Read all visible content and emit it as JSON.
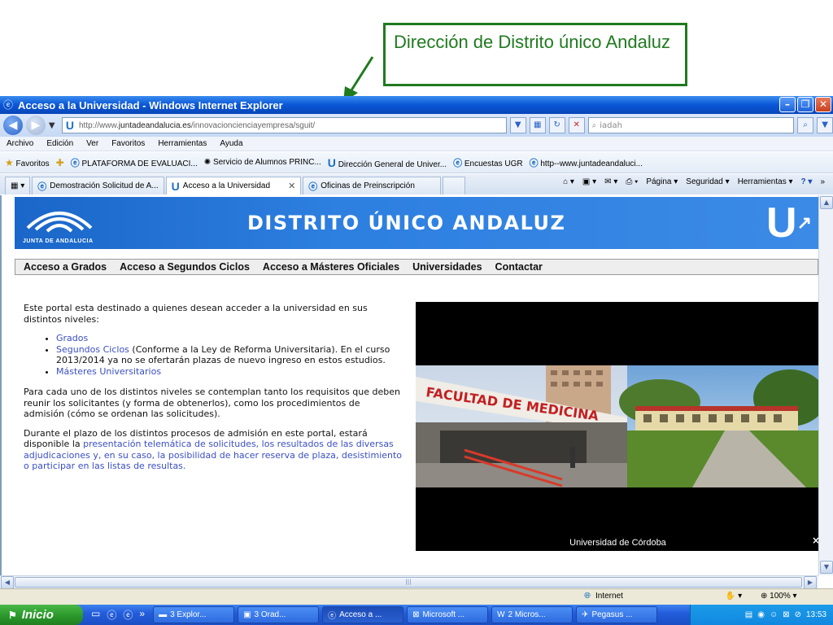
{
  "annotation": {
    "text": "Dirección de Distrito único Andaluz"
  },
  "window": {
    "title": "Acceso a la Universidad - Windows Internet Explorer"
  },
  "address": {
    "url_prefix": "http://www.",
    "url_domain": "juntadeandalucia.es",
    "url_path": "/innovacioncienciayempresa/sguit/",
    "search_value": "iadah"
  },
  "menu": [
    "Archivo",
    "Edición",
    "Ver",
    "Favoritos",
    "Herramientas",
    "Ayuda"
  ],
  "favorites": {
    "label": "Favoritos",
    "items": [
      "PLATAFORMA DE EVALUACI...",
      "Servicio de Alumnos PRINC...",
      "Dirección General de Univer...",
      "Encuestas UGR",
      "http--www.juntadeandaluci..."
    ]
  },
  "tabs": [
    {
      "label": "Demostración Solicitud de A..."
    },
    {
      "label": "Acceso a la Universidad"
    },
    {
      "label": "Oficinas de Preinscripción"
    }
  ],
  "tab_tools": {
    "page": "Página",
    "security": "Seguridad",
    "tools": "Herramientas"
  },
  "site": {
    "org": "JUNTA DE ANDALUCIA",
    "title": "DISTRITO ÚNICO ANDALUZ",
    "logo_letter": "U",
    "nav": [
      "Acceso a Grados",
      "Acceso a Segundos Ciclos",
      "Acceso a Másteres Oficiales",
      "Universidades",
      "Contactar"
    ],
    "intro": "Este portal esta destinado a quienes desean acceder a la universidad en sus distintos niveles:",
    "levels": {
      "grados": "Grados",
      "ciclos": "Segundos Ciclos",
      "ciclos_note": " (Conforme a la Ley de Reforma Universitaria). En el curso 2013/2014 ya no se ofertarán plazas de nuevo ingreso en estos estudios.",
      "masters": "Másteres Universitarios"
    },
    "para1": "Para cada uno de los distintos niveles se contemplan tanto los requisitos que deben reunir los solicitantes (y forma de obtenerlos), como los procedimientos de admisión (cómo se ordenan las solicitudes).",
    "para2_start": "Durante el plazo de los distintos procesos de admisión en este portal, estará disponible la ",
    "para2_link": "presentación telemática de solicitudes, los resultados de las diversas adjudicaciones y, en su caso, la posibilidad de hacer reserva de plaza, desistimiento o participar en las listas de resultas.",
    "photo_sign": "FACULTAD DE MEDICINA",
    "photo_caption": "Universidad de Córdoba",
    "photo_close": "×"
  },
  "status": {
    "zone": "Internet",
    "zoom": "100%"
  },
  "taskbar": {
    "start": "Inicio",
    "tasks": [
      "3 Explor...",
      "3 Orad...",
      "Acceso a ...",
      "Microsoft ...",
      "2 Micros...",
      "Pegasus ..."
    ],
    "clock": "13:53"
  }
}
